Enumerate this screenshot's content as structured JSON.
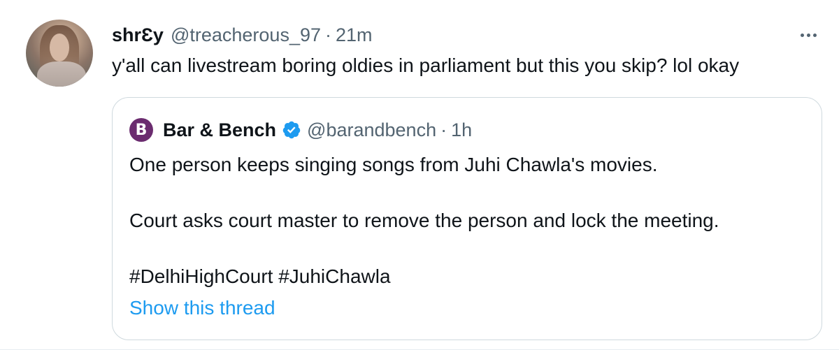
{
  "tweet": {
    "display_name": "shrƐy",
    "handle": "@treacherous_97",
    "separator": "·",
    "time": "21m",
    "text": "y'all can livestream boring oldies in parliament but this you skip? lol okay"
  },
  "quote": {
    "avatar_letter": "B",
    "display_name": "Bar & Bench",
    "handle": "@barandbench",
    "separator": "·",
    "time": "1h",
    "lines": [
      "One person keeps singing songs from Juhi Chawla's movies.",
      "Court asks court master to remove the person and lock the meeting.",
      "#DelhiHighCourt #JuhiChawla"
    ],
    "show_thread": "Show this thread"
  },
  "icons": {
    "more": "more-horizontal-icon",
    "verified": "verified-badge-icon"
  },
  "colors": {
    "link": "#1d9bf0",
    "secondary_text": "#536471",
    "border": "#cfd9de",
    "quote_avatar_bg": "#6b2c6f"
  }
}
